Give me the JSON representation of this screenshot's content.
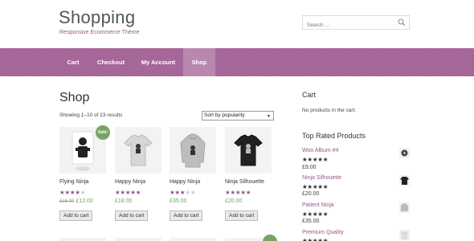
{
  "header": {
    "site_title": "Shopping",
    "tagline": "Responsive Ecommerce Theme",
    "search_placeholder": "Search ..."
  },
  "nav": {
    "items": [
      {
        "label": "Cart"
      },
      {
        "label": "Checkout"
      },
      {
        "label": "My Account"
      },
      {
        "label": "Shop"
      }
    ],
    "active": "Shop"
  },
  "main": {
    "title": "Shop",
    "result_count": "Showing 1–10 of 23 results",
    "sort_selected": "Sort by popularity",
    "products": [
      {
        "name": "Flying Ninja",
        "rating": 4,
        "old_price": "£15.00",
        "price": "£12.00",
        "sale": true,
        "sale_label": "Sale!",
        "button": "Add to cart",
        "image": "poster-icon"
      },
      {
        "name": "Happy Ninja",
        "rating": 5,
        "price": "£18.00",
        "sale": false,
        "button": "Add to cart",
        "image": "tshirt-icon"
      },
      {
        "name": "Happy Ninja",
        "rating": 3,
        "price": "£35.00",
        "sale": false,
        "button": "Add to cart",
        "image": "hoodie-icon"
      },
      {
        "name": "Ninja Silhouette",
        "rating": 5,
        "price": "£20.00",
        "sale": false,
        "button": "Add to cart",
        "image": "tshirt-black-icon"
      }
    ]
  },
  "sidebar": {
    "cart_title": "Cart",
    "cart_empty": "No products in the cart.",
    "top_rated_title": "Top Rated Products",
    "top_rated": [
      {
        "name": "Woo Album #4",
        "rating": 5,
        "price": "£9.00",
        "image": "album-icon"
      },
      {
        "name": "Ninja Silhouette",
        "rating": 5,
        "price": "£20.00",
        "image": "tshirt-black-icon"
      },
      {
        "name": "Patient Ninja",
        "rating": 5,
        "price": "£35.00",
        "image": "hoodie-icon"
      },
      {
        "name": "Premium Quality",
        "rating": 5,
        "price": "",
        "image": "tshirt-icon"
      }
    ]
  },
  "colors": {
    "brand": "#96588a",
    "nav_bg": "#a46497",
    "price": "#77a464",
    "sale_badge": "#77a464"
  }
}
